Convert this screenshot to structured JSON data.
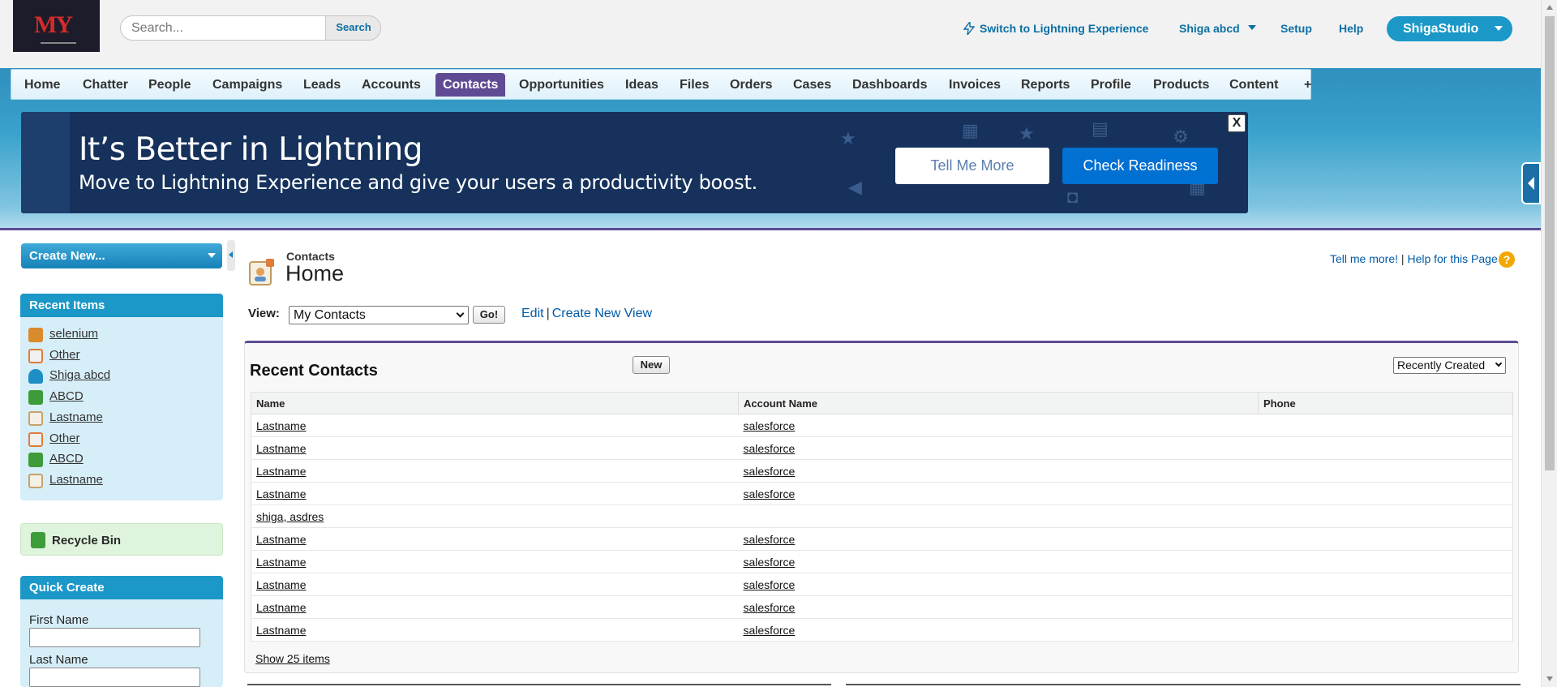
{
  "header": {
    "logo_text": "MY",
    "search_placeholder": "Search...",
    "search_button": "Search",
    "switch_lightning": "Switch to Lightning Experience",
    "user_name": "Shiga abcd",
    "setup": "Setup",
    "help": "Help",
    "app_name": "ShigaStudio"
  },
  "tabs": [
    {
      "label": "Home"
    },
    {
      "label": "Chatter"
    },
    {
      "label": "People"
    },
    {
      "label": "Campaigns"
    },
    {
      "label": "Leads"
    },
    {
      "label": "Accounts"
    },
    {
      "label": "Contacts",
      "active": true
    },
    {
      "label": "Opportunities"
    },
    {
      "label": "Ideas"
    },
    {
      "label": "Files"
    },
    {
      "label": "Orders"
    },
    {
      "label": "Cases"
    },
    {
      "label": "Dashboards"
    },
    {
      "label": "Invoices"
    },
    {
      "label": "Reports"
    },
    {
      "label": "Profile"
    },
    {
      "label": "Products"
    },
    {
      "label": "Content"
    },
    {
      "label": "+"
    }
  ],
  "banner": {
    "title": "It’s Better in Lightning",
    "subtitle": "Move to Lightning Experience and give your users a productivity boost.",
    "tell_more": "Tell Me More",
    "check_readiness": "Check Readiness",
    "close": "X"
  },
  "sidebar": {
    "create_new": "Create New...",
    "recent_items_title": "Recent Items",
    "recent_items": [
      {
        "label": "selenium",
        "icon": "account-icon"
      },
      {
        "label": "Other",
        "icon": "case-icon"
      },
      {
        "label": "Shiga abcd",
        "icon": "user-icon"
      },
      {
        "label": "ABCD",
        "icon": "lead-icon"
      },
      {
        "label": "Lastname",
        "icon": "contact-icon"
      },
      {
        "label": "Other",
        "icon": "case-icon"
      },
      {
        "label": "ABCD",
        "icon": "lead-icon"
      },
      {
        "label": "Lastname",
        "icon": "contact-icon"
      }
    ],
    "recycle_bin": "Recycle Bin",
    "quick_create_title": "Quick Create",
    "first_name_label": "First Name",
    "last_name_label": "Last Name"
  },
  "page": {
    "eyebrow": "Contacts",
    "title": "Home",
    "tell_me_more": "Tell me more!",
    "help_page": "Help for this Page",
    "help_icon": "?",
    "view_label": "View:",
    "view_selected": "My Contacts",
    "go": "Go!",
    "edit": "Edit",
    "create_new_view": "Create New View"
  },
  "recent_contacts": {
    "title": "Recent Contacts",
    "new_button": "New",
    "sort_selected": "Recently Created",
    "columns": [
      "Name",
      "Account Name",
      "Phone"
    ],
    "rows": [
      {
        "name": "Lastname",
        "account": "salesforce",
        "phone": ""
      },
      {
        "name": "Lastname",
        "account": "salesforce",
        "phone": ""
      },
      {
        "name": "Lastname",
        "account": "salesforce",
        "phone": ""
      },
      {
        "name": "Lastname",
        "account": "salesforce",
        "phone": ""
      },
      {
        "name": "shiga, asdres",
        "account": "",
        "phone": ""
      },
      {
        "name": "Lastname",
        "account": "salesforce",
        "phone": ""
      },
      {
        "name": "Lastname",
        "account": "salesforce",
        "phone": ""
      },
      {
        "name": "Lastname",
        "account": "salesforce",
        "phone": ""
      },
      {
        "name": "Lastname",
        "account": "salesforce",
        "phone": ""
      },
      {
        "name": "Lastname",
        "account": "salesforce",
        "phone": ""
      }
    ],
    "show_more": "Show 25 items"
  },
  "colors": {
    "accent": "#1b98c7",
    "tab_active": "#5f4b94",
    "banner_bg": "#16325c",
    "link": "#015ba7"
  }
}
